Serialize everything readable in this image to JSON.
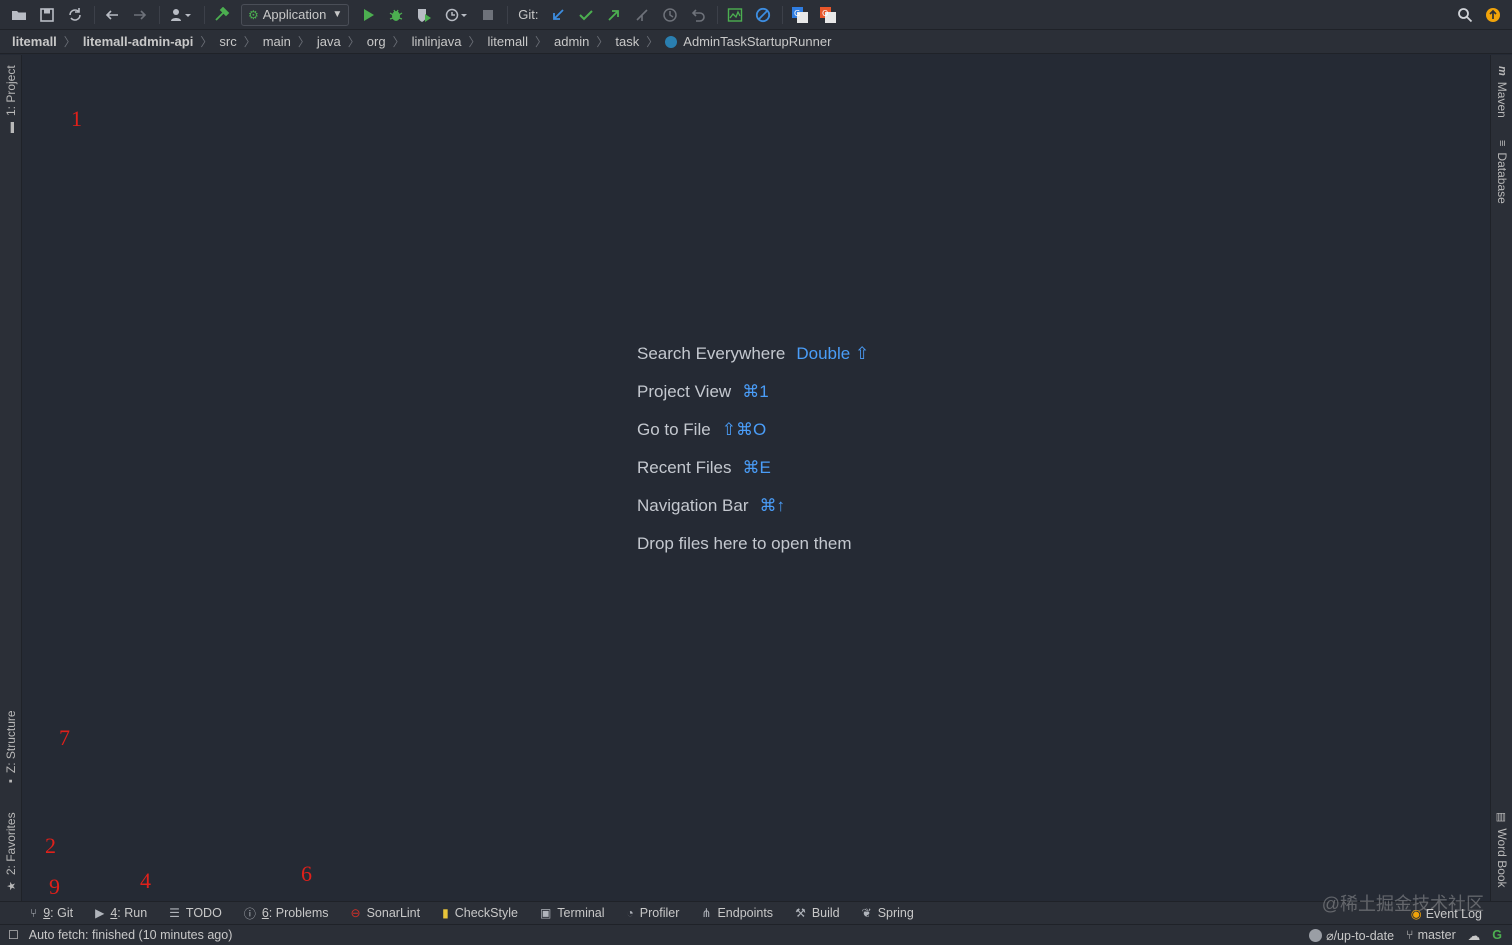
{
  "toolbar": {
    "run_config": "Application",
    "git_label": "Git:"
  },
  "breadcrumb": [
    "litemall",
    "litemall-admin-api",
    "src",
    "main",
    "java",
    "org",
    "linlinjava",
    "litemall",
    "admin",
    "task",
    "AdminTaskStartupRunner"
  ],
  "left_tabs": {
    "project": "1: Project",
    "structure": "Z: Structure",
    "favorites": "2: Favorites"
  },
  "right_tabs": {
    "maven": "Maven",
    "database": "Database",
    "word_book": "Word Book"
  },
  "hints": [
    {
      "label": "Search Everywhere",
      "shortcut": "Double ⇧"
    },
    {
      "label": "Project View",
      "shortcut": "⌘1"
    },
    {
      "label": "Go to File",
      "shortcut": "⇧⌘O"
    },
    {
      "label": "Recent Files",
      "shortcut": "⌘E"
    },
    {
      "label": "Navigation Bar",
      "shortcut": "⌘↑"
    },
    {
      "label": "Drop files here to open them",
      "shortcut": ""
    }
  ],
  "annotations": [
    "1",
    "7",
    "2",
    "9",
    "4",
    "6"
  ],
  "bottom_tabs": {
    "git_num": "9",
    "git": ": Git",
    "run_num": "4",
    "run": ": Run",
    "todo": "TODO",
    "problems_num": "6",
    "problems": ": Problems",
    "sonarlint": "SonarLint",
    "checkstyle": "CheckStyle",
    "terminal": "Terminal",
    "profiler": "Profiler",
    "endpoints": "Endpoints",
    "build": "Build",
    "spring": "Spring",
    "event_log": "Event Log"
  },
  "watermark": "@稀土掘金技术社区",
  "status": {
    "message": "Auto fetch: finished (10 minutes ago)",
    "vcs_state": "⌀/up-to-date",
    "branch": "master"
  },
  "colors": {
    "background": "#252a34",
    "shortcut": "#4a9df8",
    "annotation": "#e0201a",
    "run_green": "#4caf50"
  }
}
